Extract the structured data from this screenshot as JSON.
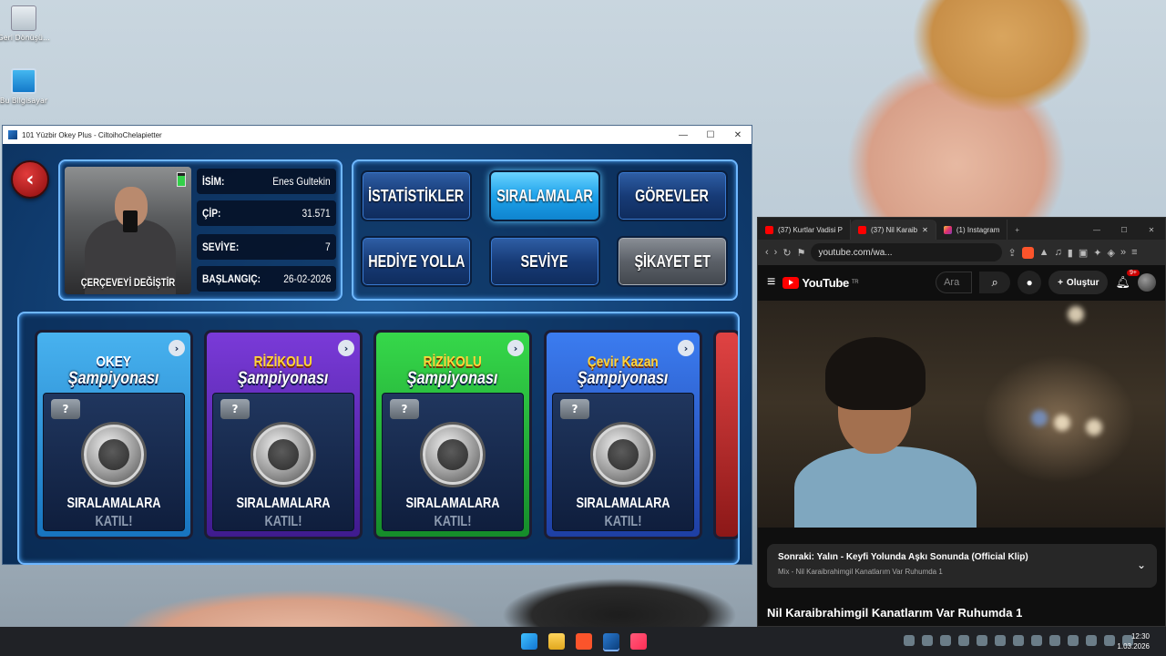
{
  "desktop": {
    "icons": [
      {
        "label": "Geri Dönüşü..."
      },
      {
        "label": "Bu Bilgisayar"
      }
    ]
  },
  "game_window": {
    "title": "101 Yüzbir Okey Plus - CiltoihoChelapietter",
    "profile": {
      "frame_label": "ÇERÇEVEYİ DEĞİŞTİR",
      "stats": [
        {
          "key": "İSİM:",
          "value": "Enes Gultekin"
        },
        {
          "key": "ÇİP:",
          "value": "31.571"
        },
        {
          "key": "SEVİYE:",
          "value": "7"
        },
        {
          "key": "BAŞLANGIÇ:",
          "value": "26-02-2026"
        }
      ]
    },
    "menu": [
      {
        "label": "İSTATİSTİKLER",
        "state": "normal"
      },
      {
        "label": "SIRALAMALAR",
        "state": "active"
      },
      {
        "label": "GÖREVLER",
        "state": "normal"
      },
      {
        "label": "HEDİYE YOLLA",
        "state": "normal"
      },
      {
        "label": "SEVİYE",
        "state": "normal"
      },
      {
        "label": "ŞİKAYET ET",
        "state": "disabled"
      }
    ],
    "tournaments": [
      {
        "logo_top": "OKEY",
        "logo_main": "Şampiyonası",
        "badge": "?",
        "cta_line1": "SIRALAMALARA",
        "cta_line2": "KATIL!"
      },
      {
        "logo_top": "RİZİKOLU",
        "logo_main": "Şampiyonası",
        "badge": "?",
        "cta_line1": "SIRALAMALARA",
        "cta_line2": "KATIL!"
      },
      {
        "logo_top": "RİZİKOLU",
        "logo_main": "Şampiyonası",
        "badge": "?",
        "cta_line1": "SIRALAMALARA",
        "cta_line2": "KATIL!"
      },
      {
        "logo_top": "Çevir Kazan",
        "logo_main": "Şampiyonası",
        "badge": "?",
        "cta_line1": "SIRALAMALARA",
        "cta_line2": "KATIL!"
      }
    ]
  },
  "browser": {
    "tabs": [
      {
        "label": "(37) Kurtlar Vadisi P"
      },
      {
        "label": "(37) Nil Karaib"
      },
      {
        "label": "(1) Instagram"
      }
    ],
    "url": "youtube.com/wa...",
    "youtube": {
      "logo": "YouTube",
      "region": "TR",
      "search_placeholder": "Ara",
      "create_label": "Oluştur",
      "notifications": "9+",
      "up_next_title": "Sonraki: Yalın - Keyfi Yolunda Aşkı Sonunda (Official Klip)",
      "up_next_sub": "Mix - Nil Karaibrahimgil Kanatlarım Var Ruhumda 1",
      "video_title": "Nil Karaibrahimgil Kanatlarım Var Ruhumda 1"
    }
  },
  "taskbar": {
    "time": "12:30",
    "date": "1.03.2026"
  }
}
